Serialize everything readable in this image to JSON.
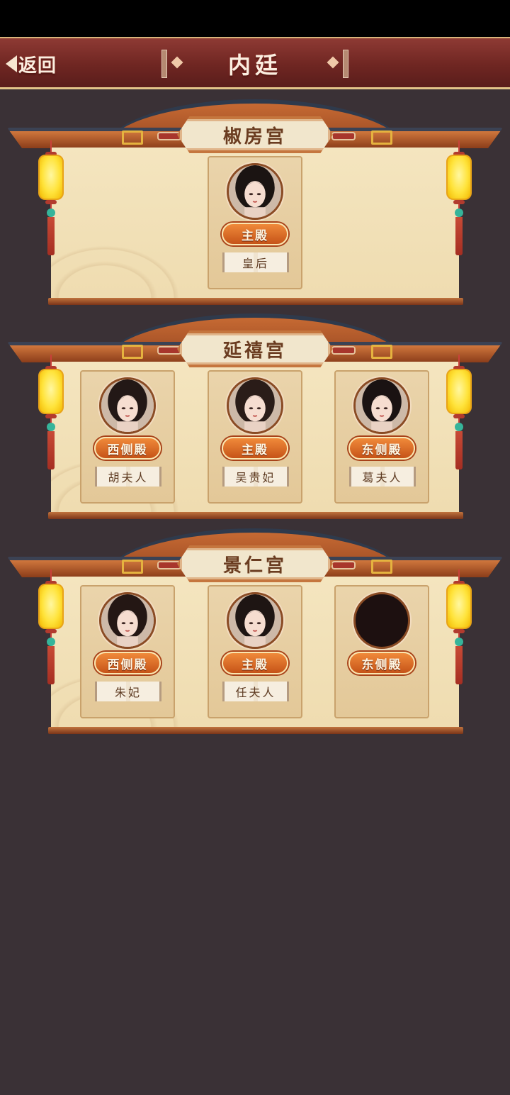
{
  "header": {
    "back_label": "返回",
    "title": "内廷"
  },
  "palaces": [
    {
      "name": "椒房宫",
      "slots": [
        {
          "hall": "主殿",
          "consort": "皇后",
          "avatar": "portrait-empress"
        }
      ]
    },
    {
      "name": "延禧宫",
      "slots": [
        {
          "hall": "西侧殿",
          "consort": "胡夫人",
          "avatar": "portrait-consort"
        },
        {
          "hall": "主殿",
          "consort": "吴贵妃",
          "avatar": "portrait-consort"
        },
        {
          "hall": "东侧殿",
          "consort": "葛夫人",
          "avatar": "portrait-consort"
        }
      ]
    },
    {
      "name": "景仁宫",
      "slots": [
        {
          "hall": "西侧殿",
          "consort": "朱妃",
          "avatar": "portrait-consort"
        },
        {
          "hall": "主殿",
          "consort": "任夫人",
          "avatar": "portrait-consort"
        },
        {
          "hall": "东侧殿",
          "consort": "",
          "avatar": "empty"
        }
      ]
    }
  ],
  "colors": {
    "background": "#3a3136",
    "topbar": "#6f2622",
    "panel": "#f4e5bf",
    "badge": "#e07028",
    "lantern": "#ffe33a"
  }
}
